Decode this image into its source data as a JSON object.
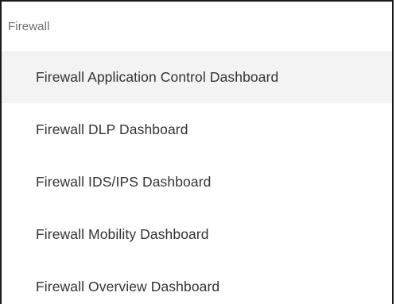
{
  "dropdown": {
    "group_label": "Firewall",
    "items": [
      {
        "label": "Firewall Application Control Dashboard",
        "highlighted": true
      },
      {
        "label": "Firewall DLP Dashboard",
        "highlighted": false
      },
      {
        "label": "Firewall IDS/IPS Dashboard",
        "highlighted": false
      },
      {
        "label": "Firewall Mobility Dashboard",
        "highlighted": false
      },
      {
        "label": "Firewall Overview Dashboard",
        "highlighted": false
      }
    ]
  },
  "colors": {
    "border": "#1a1a1a",
    "highlight_background": "#f3f3f3",
    "group_label_text": "#6e6e6e",
    "item_text": "#333333"
  }
}
